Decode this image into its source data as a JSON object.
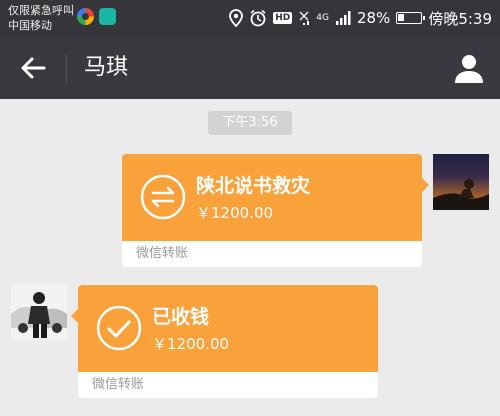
{
  "status": {
    "carrier_line1": "仅限紧急呼叫",
    "carrier_line2": "中国移动",
    "battery": "28%",
    "time": "傍晚5:39",
    "hd": "HD",
    "net": "4G"
  },
  "header": {
    "title": "马琪"
  },
  "chat": {
    "timestamp": "下午3:56",
    "messages": [
      {
        "title": "陕北说书救灾",
        "amount": "￥1200.00",
        "footer": "微信转账"
      },
      {
        "title": "已收钱",
        "amount": "￥1200.00",
        "footer": "微信转账"
      }
    ]
  },
  "colors": {
    "accent": "#f9a13b",
    "titlebar": "#393a3f",
    "background": "#ebebeb"
  }
}
